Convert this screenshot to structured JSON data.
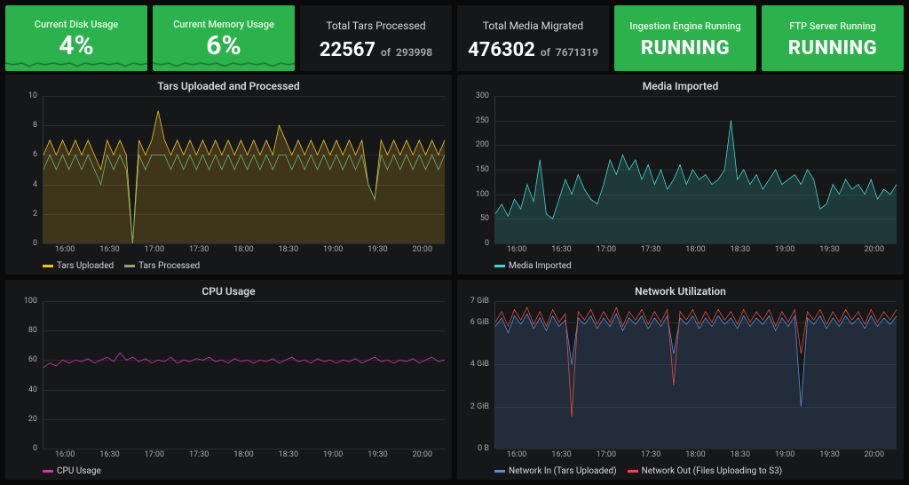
{
  "top": {
    "disk": {
      "title": "Current Disk Usage",
      "value": "4%"
    },
    "memory": {
      "title": "Current Memory Usage",
      "value": "6%"
    },
    "tars": {
      "title": "Total Tars Processed",
      "value": "22567",
      "of_label": "of",
      "total": "293998"
    },
    "media": {
      "title": "Total Media Migrated",
      "value": "476302",
      "of_label": "of",
      "total": "7671319"
    },
    "ingest": {
      "title": "Ingestion Engine Running",
      "status": "RUNNING"
    },
    "ftp": {
      "title": "FTP Server Running",
      "status": "RUNNING"
    }
  },
  "colors": {
    "green_card": "#2bb24c",
    "tars_uploaded": "#f2c41f",
    "tars_processed": "#7eb26d",
    "media_imported": "#3fd7cf",
    "cpu": "#d137a8",
    "net_in": "#5a8fd6",
    "net_out": "#e24d42"
  },
  "time_axis": {
    "ticks": [
      "16:00",
      "16:30",
      "17:00",
      "17:30",
      "18:00",
      "18:30",
      "19:00",
      "19:30",
      "20:00"
    ]
  },
  "chart_data": [
    {
      "id": "tars",
      "type": "line",
      "title": "Tars Uploaded and Processed",
      "xlabel": "",
      "ylabel": "",
      "ylim": [
        0,
        10
      ],
      "yticks": [
        0,
        2,
        4,
        6,
        8,
        10
      ],
      "x_ticks": [
        "16:00",
        "16:30",
        "17:00",
        "17:30",
        "18:00",
        "18:30",
        "19:00",
        "19:30",
        "20:00"
      ],
      "series": [
        {
          "name": "Tars Uploaded",
          "color": "#f2c41f",
          "values": [
            6,
            7,
            6,
            7,
            6,
            7,
            6,
            7,
            6,
            5,
            7,
            6,
            7,
            6,
            0,
            7,
            6,
            7,
            9,
            7,
            6,
            7,
            6,
            7,
            6,
            7,
            6,
            7,
            6,
            7,
            6,
            7,
            6,
            7,
            6,
            7,
            6,
            8,
            7,
            6,
            7,
            6,
            7,
            6,
            7,
            6,
            7,
            6,
            7,
            6,
            7,
            4,
            3,
            7,
            6,
            7,
            6,
            7,
            6,
            7,
            6,
            7,
            6,
            7
          ]
        },
        {
          "name": "Tars Processed",
          "color": "#7eb26d",
          "values": [
            5,
            6,
            5,
            6,
            5,
            6,
            5,
            6,
            5,
            4,
            6,
            5,
            6,
            5,
            0,
            6,
            5,
            6,
            6,
            6,
            5,
            6,
            5,
            6,
            5,
            6,
            5,
            6,
            5,
            6,
            5,
            6,
            5,
            6,
            5,
            6,
            5,
            6,
            6,
            5,
            6,
            5,
            6,
            5,
            6,
            5,
            6,
            5,
            6,
            5,
            6,
            4,
            3,
            6,
            5,
            6,
            5,
            6,
            5,
            6,
            5,
            6,
            5,
            6
          ]
        }
      ],
      "fill_under_first": true,
      "legend": [
        "Tars Uploaded",
        "Tars Processed"
      ]
    },
    {
      "id": "media",
      "type": "area",
      "title": "Media Imported",
      "xlabel": "",
      "ylabel": "",
      "ylim": [
        0,
        300
      ],
      "yticks": [
        0,
        50,
        100,
        150,
        200,
        250,
        300
      ],
      "x_ticks": [
        "16:00",
        "16:30",
        "17:00",
        "17:30",
        "18:00",
        "18:30",
        "19:00",
        "19:30",
        "20:00"
      ],
      "series": [
        {
          "name": "Media Imported",
          "color": "#3fd7cf",
          "values": [
            60,
            80,
            55,
            90,
            70,
            120,
            85,
            170,
            60,
            50,
            90,
            130,
            100,
            140,
            110,
            90,
            80,
            120,
            170,
            140,
            180,
            150,
            170,
            130,
            160,
            120,
            150,
            110,
            130,
            160,
            120,
            150,
            130,
            140,
            120,
            130,
            150,
            250,
            130,
            150,
            120,
            140,
            110,
            130,
            150,
            120,
            130,
            140,
            120,
            150,
            130,
            70,
            80,
            120,
            100,
            130,
            110,
            120,
            100,
            130,
            90,
            110,
            100,
            120
          ]
        }
      ],
      "legend": [
        "Media Imported"
      ]
    },
    {
      "id": "cpu",
      "type": "line",
      "title": "CPU Usage",
      "xlabel": "",
      "ylabel": "",
      "ylim": [
        0,
        100
      ],
      "yticks": [
        0,
        20,
        40,
        60,
        80,
        100
      ],
      "x_ticks": [
        "16:00",
        "16:30",
        "17:00",
        "17:30",
        "18:00",
        "18:30",
        "19:00",
        "19:30",
        "20:00"
      ],
      "series": [
        {
          "name": "CPU Usage",
          "color": "#d137a8",
          "values": [
            55,
            58,
            56,
            60,
            58,
            60,
            59,
            61,
            58,
            60,
            62,
            59,
            65,
            60,
            62,
            59,
            61,
            58,
            60,
            59,
            62,
            58,
            60,
            59,
            61,
            60,
            62,
            59,
            60,
            58,
            61,
            59,
            60,
            58,
            60,
            59,
            61,
            58,
            60,
            62,
            59,
            60,
            58,
            61,
            59,
            60,
            58,
            60,
            59,
            61,
            58,
            60,
            62,
            59,
            60,
            58,
            60,
            59,
            61,
            58,
            60,
            62,
            59,
            60
          ]
        }
      ],
      "legend": [
        "CPU Usage"
      ]
    },
    {
      "id": "net",
      "type": "line",
      "title": "Network Utilization",
      "xlabel": "",
      "ylabel": "",
      "ylim": [
        0,
        7
      ],
      "yticks_labels": [
        "0 B",
        "2 GiB",
        "4 GiB",
        "6 GiB",
        "7 GiB"
      ],
      "yticks": [
        0,
        2,
        4,
        6,
        7
      ],
      "x_ticks": [
        "16:00",
        "16:30",
        "17:00",
        "17:30",
        "18:00",
        "18:30",
        "19:00",
        "19:30",
        "20:00"
      ],
      "series": [
        {
          "name": "Network In (Tars Uploaded)",
          "color": "#5a8fd6",
          "values": [
            5.8,
            6.2,
            5.5,
            6.3,
            5.9,
            6.4,
            5.7,
            6.2,
            5.6,
            6.3,
            5.8,
            6.1,
            4.0,
            6.2,
            5.9,
            6.3,
            5.7,
            6.2,
            5.8,
            6.4,
            5.6,
            6.2,
            5.9,
            6.3,
            5.7,
            6.2,
            5.8,
            6.3,
            4.5,
            6.2,
            5.9,
            6.3,
            5.7,
            6.2,
            5.8,
            6.3,
            5.9,
            6.2,
            5.7,
            6.3,
            5.8,
            6.2,
            5.9,
            6.3,
            5.6,
            6.2,
            5.8,
            6.3,
            2.0,
            6.2,
            5.9,
            6.3,
            5.7,
            6.2,
            5.8,
            6.3,
            5.9,
            6.2,
            5.7,
            6.3,
            5.8,
            6.2,
            5.9,
            6.3
          ]
        },
        {
          "name": "Network Out (Files Uploading to S3)",
          "color": "#e24d42",
          "values": [
            6.0,
            6.5,
            5.8,
            6.6,
            6.1,
            6.7,
            5.9,
            6.5,
            5.8,
            6.6,
            6.0,
            6.4,
            1.5,
            6.5,
            6.1,
            6.6,
            5.9,
            6.5,
            6.0,
            6.7,
            5.8,
            6.5,
            6.1,
            6.6,
            5.9,
            6.5,
            6.0,
            6.6,
            3.0,
            6.5,
            6.1,
            6.6,
            5.9,
            6.5,
            6.0,
            6.6,
            6.1,
            6.5,
            5.9,
            6.6,
            6.0,
            6.5,
            6.1,
            6.6,
            5.8,
            6.5,
            6.0,
            6.6,
            4.5,
            6.5,
            6.1,
            6.6,
            5.9,
            6.5,
            6.0,
            6.6,
            6.1,
            6.5,
            5.9,
            6.6,
            6.0,
            6.5,
            6.1,
            6.6
          ]
        }
      ],
      "fill_under_first": true,
      "legend": [
        "Network In (Tars Uploaded)",
        "Network Out (Files Uploading to S3)"
      ]
    }
  ]
}
